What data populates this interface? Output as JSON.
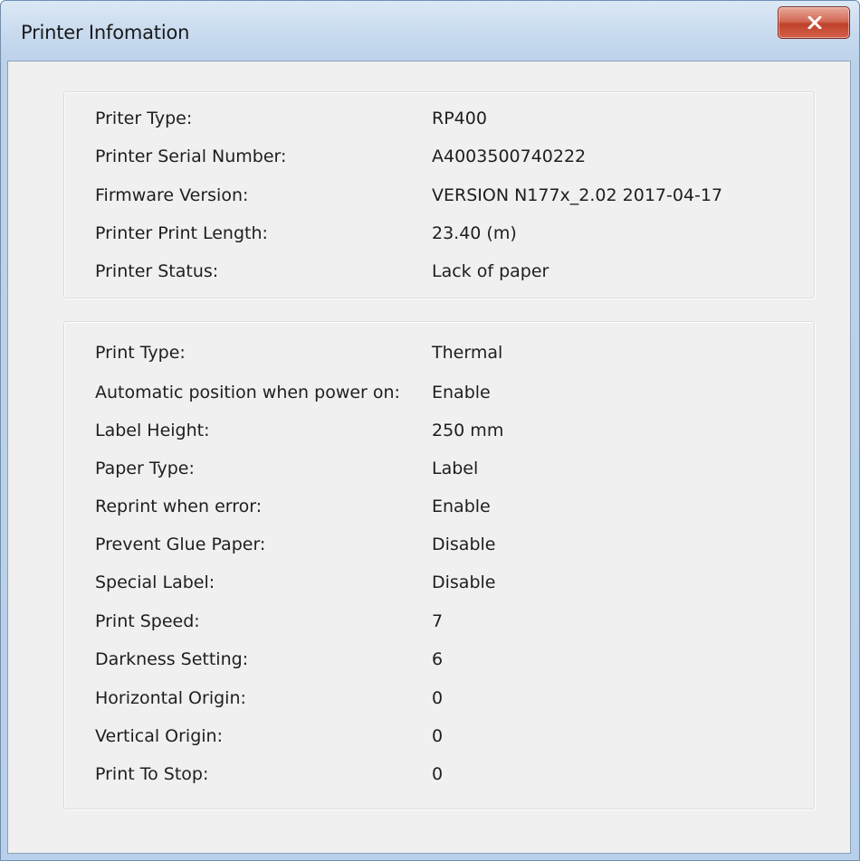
{
  "window": {
    "title": "Printer Infomation",
    "close_label": "close"
  },
  "printer_info": [
    {
      "label": "Priter Type:",
      "value": "RP400"
    },
    {
      "label": "Printer Serial Number:",
      "value": "A4003500740222"
    },
    {
      "label": "Firmware Version:",
      "value": "VERSION N177x_2.02 2017-04-17"
    },
    {
      "label": "Printer Print Length:",
      "value": "23.40 (m)"
    },
    {
      "label": "Printer Status:",
      "value": "Lack of paper"
    }
  ],
  "print_settings": [
    {
      "label": "Print Type:",
      "value": "Thermal"
    },
    {
      "label": "Automatic position when power on:",
      "value": "Enable"
    },
    {
      "label": "Label Height:",
      "value": "250 mm"
    },
    {
      "label": "Paper Type:",
      "value": "Label"
    },
    {
      "label": "Reprint when error:",
      "value": "Enable"
    },
    {
      "label": "Prevent Glue Paper:",
      "value": "Disable"
    },
    {
      "label": "Special Label:",
      "value": "Disable"
    },
    {
      "label": "Print Speed:",
      "value": "7"
    },
    {
      "label": "Darkness Setting:",
      "value": "6"
    },
    {
      "label": "Horizontal Origin:",
      "value": "0"
    },
    {
      "label": "Vertical Origin:",
      "value": "0"
    },
    {
      "label": "Print To Stop:",
      "value": "0"
    }
  ],
  "colors": {
    "title_bar": "#c6d9ee",
    "close_button": "#c0412b",
    "client_background": "#f0f0f0"
  },
  "icons": {
    "close": "close-icon"
  }
}
